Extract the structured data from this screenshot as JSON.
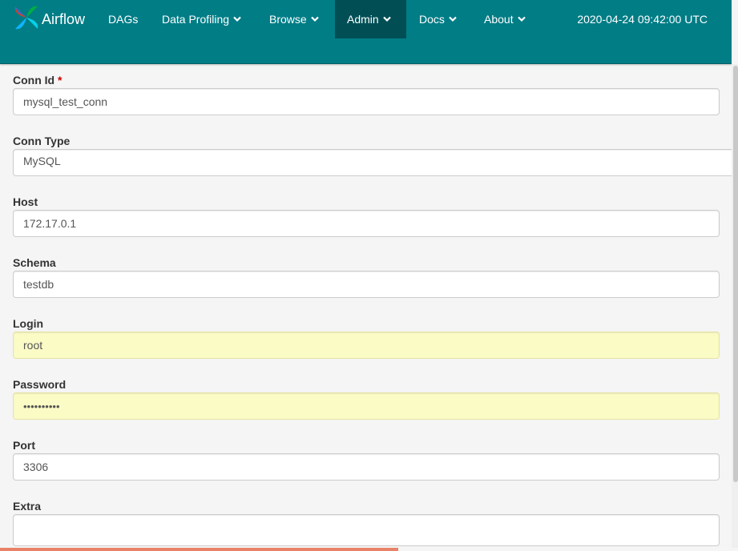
{
  "navbar": {
    "brand": "Airflow",
    "items": [
      {
        "label": "DAGs",
        "dropdown": false
      },
      {
        "label": "Data Profiling",
        "dropdown": true
      },
      {
        "label": "Browse",
        "dropdown": true
      },
      {
        "label": "Admin",
        "dropdown": true,
        "active": true
      },
      {
        "label": "Docs",
        "dropdown": true
      },
      {
        "label": "About",
        "dropdown": true
      }
    ],
    "clock": "2020-04-24 09:42:00 UTC"
  },
  "form": {
    "conn_id": {
      "label": "Conn Id",
      "required_mark": "*",
      "value": "mysql_test_conn"
    },
    "conn_type": {
      "label": "Conn Type",
      "value": "MySQL"
    },
    "host": {
      "label": "Host",
      "value": "172.17.0.1"
    },
    "schema": {
      "label": "Schema",
      "value": "testdb"
    },
    "login": {
      "label": "Login",
      "value": "root"
    },
    "password": {
      "label": "Password",
      "value": "••••••••••"
    },
    "port": {
      "label": "Port",
      "value": "3306"
    },
    "extra": {
      "label": "Extra",
      "value": ""
    }
  },
  "progress": {
    "fraction": 0.54
  },
  "colors": {
    "navbar_bg": "#017d86",
    "nav_active_bg": "#014f55",
    "autofill_bg": "#fbfbc6",
    "required": "#cc0000",
    "progress": "#e8836a"
  }
}
